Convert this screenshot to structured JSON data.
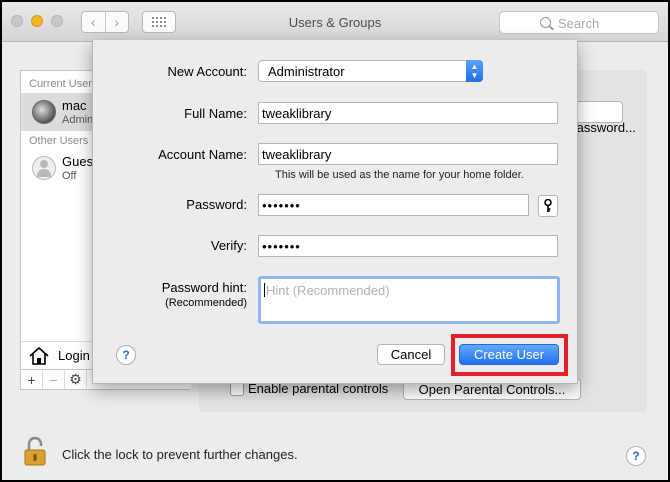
{
  "window": {
    "title": "Users & Groups",
    "search_placeholder": "Search"
  },
  "sidebar": {
    "current_users_label": "Current Users",
    "other_users_label": "Other Users",
    "users": [
      {
        "name": "mac",
        "role": "Admin",
        "selected": true
      },
      {
        "name": "Guest User",
        "role": "Off",
        "selected": false
      }
    ],
    "login_label": "Login Options",
    "tools": [
      "+",
      "−",
      "gear-icon"
    ]
  },
  "main": {
    "change_password_label": "Change Password...",
    "parental_controls_label": "Enable parental controls",
    "parental_controls_checked": false,
    "open_parental_label": "Open Parental Controls..."
  },
  "footer": {
    "lock_text": "Click the lock to prevent further changes."
  },
  "sheet": {
    "new_account_label": "New Account:",
    "new_account_value": "Administrator",
    "full_name_label": "Full Name:",
    "full_name_value": "tweaklibrary",
    "account_name_label": "Account Name:",
    "account_name_value": "tweaklibrary",
    "account_name_note": "This will be used as the name for your home folder.",
    "password_label": "Password:",
    "password_value": "•••••••",
    "verify_label": "Verify:",
    "verify_value": "•••••••",
    "hint_label": "Password hint:",
    "hint_sub_label": "(Recommended)",
    "hint_placeholder": "Hint (Recommended)",
    "cancel_label": "Cancel",
    "create_label": "Create User",
    "help_glyph": "?",
    "accent_color": "#1f70ee",
    "highlight_color": "#e32028"
  }
}
